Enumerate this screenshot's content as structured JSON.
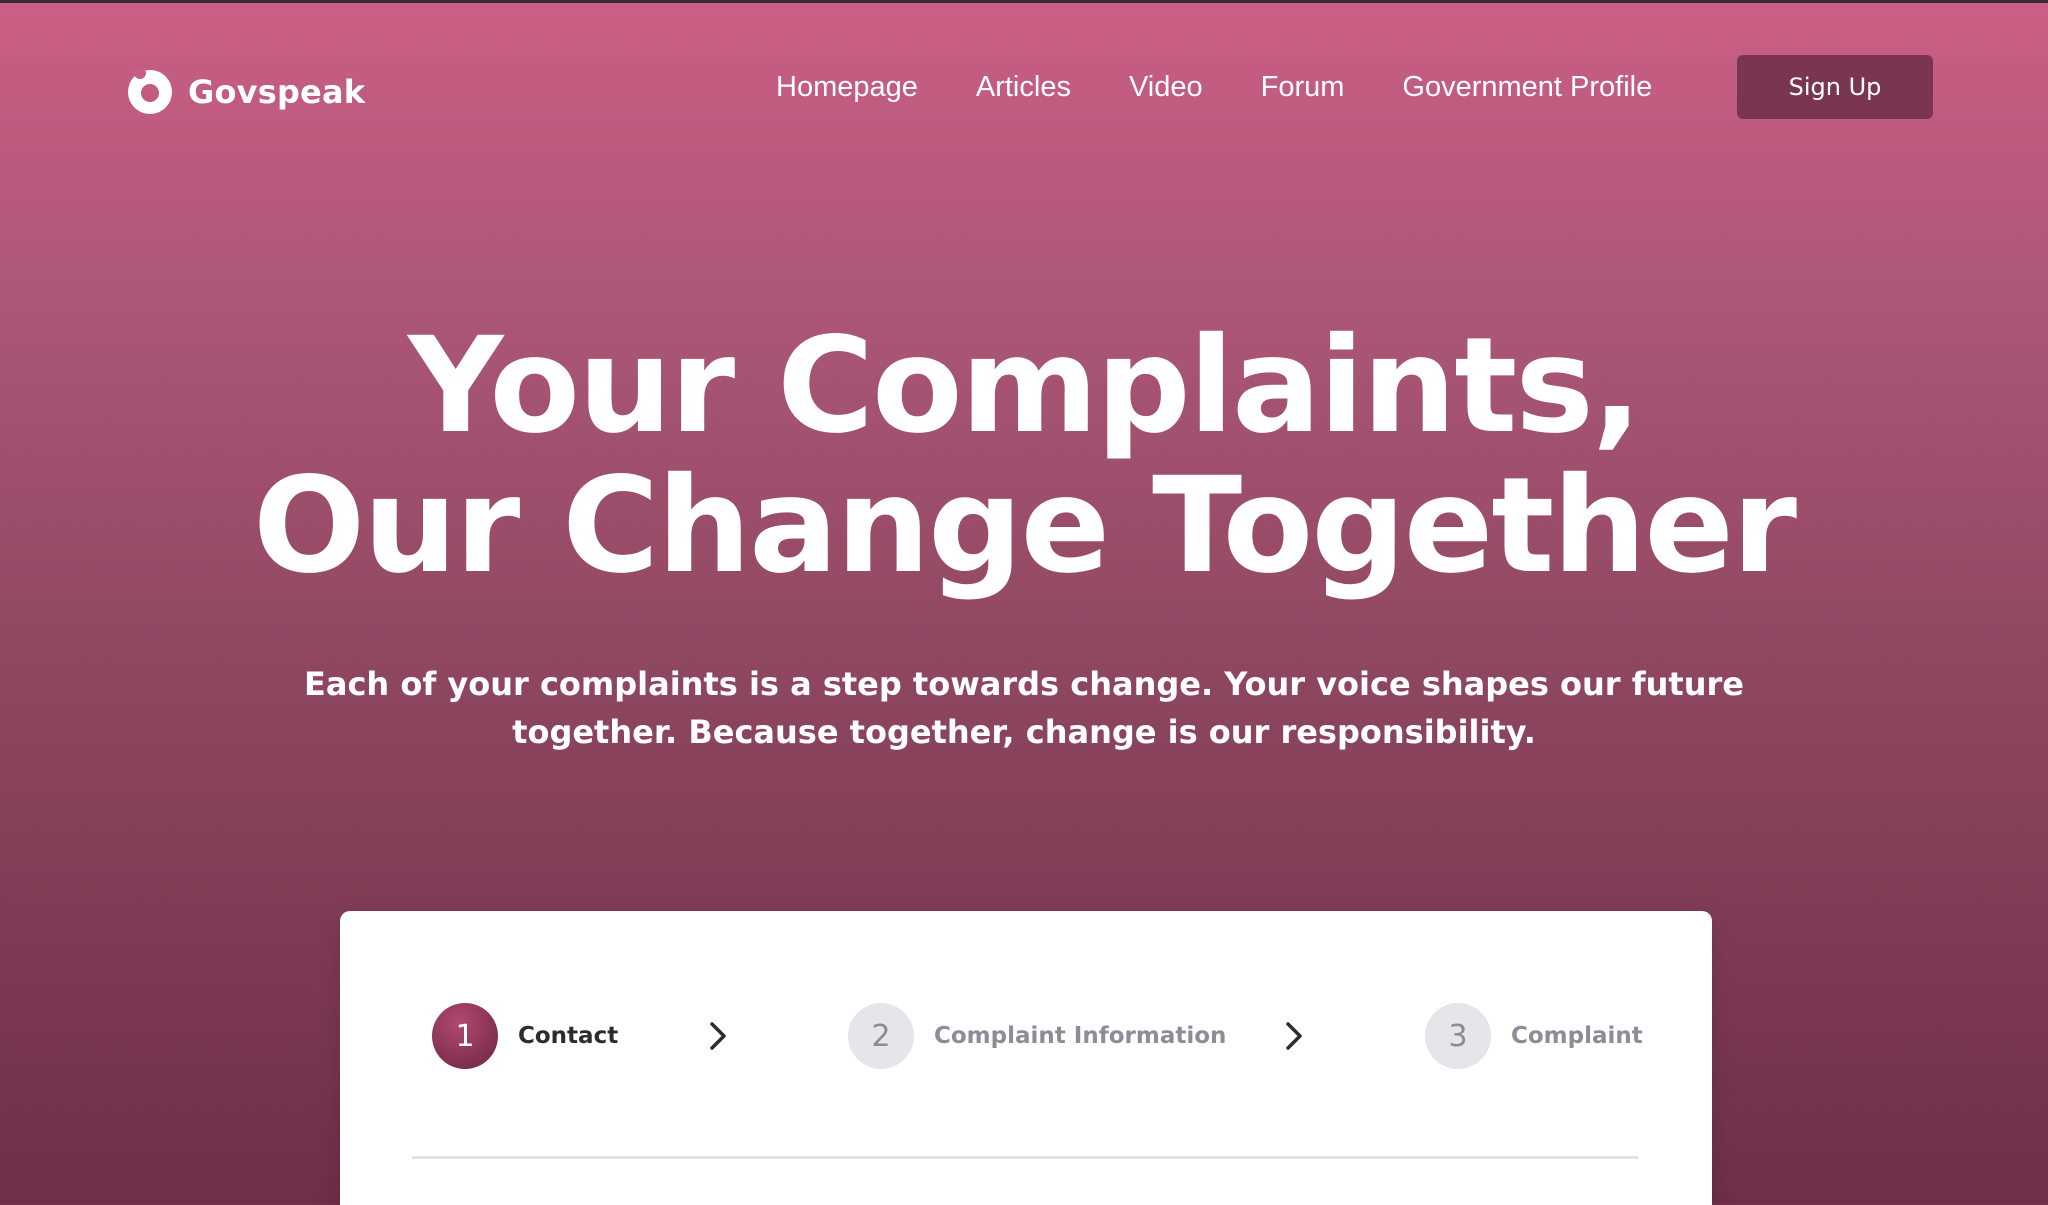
{
  "brand": {
    "name": "Govspeak",
    "logo_icon": "govspeak-logo-icon"
  },
  "nav": {
    "links": [
      "Homepage",
      "Articles",
      "Video",
      "Forum",
      "Government Profile"
    ],
    "signup_label": "Sign Up"
  },
  "hero": {
    "title_line1": "Your Complaints,",
    "title_line2": "Our Change Together",
    "subtitle_line1": "Each of your complaints is a step towards change. Your voice shapes our future",
    "subtitle_line2": "together. Because together, change is our responsibility."
  },
  "form": {
    "steps": [
      {
        "number": "1",
        "label": "Contact",
        "state": "active"
      },
      {
        "number": "2",
        "label": "Complaint Information",
        "state": "inactive"
      },
      {
        "number": "3",
        "label": "Complaint",
        "state": "inactive"
      }
    ],
    "separator_icon": "chevron-right-icon"
  },
  "colors": {
    "gradient_top": "#cb5e84",
    "gradient_bottom": "#6e2f48",
    "signup_bg": "#7a3552",
    "step_active": "#8a2f55",
    "step_inactive": "#e6e6ea"
  }
}
